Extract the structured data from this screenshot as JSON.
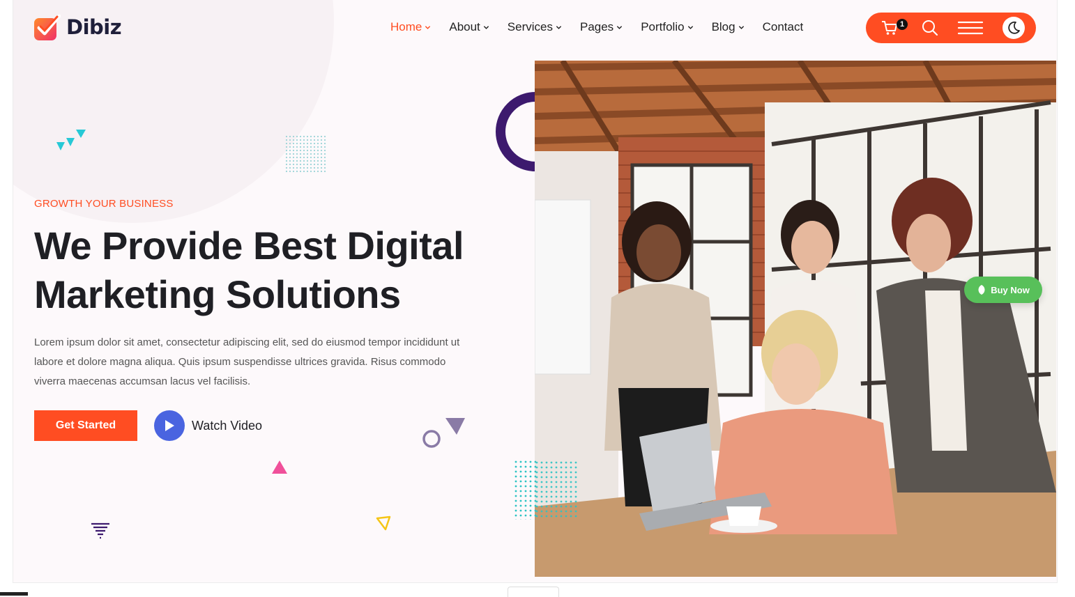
{
  "brand": {
    "name": "Dibiz",
    "accent": "#ff4d22"
  },
  "nav": {
    "items": [
      {
        "label": "Home",
        "dropdown": true,
        "active": true
      },
      {
        "label": "About",
        "dropdown": true
      },
      {
        "label": "Services",
        "dropdown": true
      },
      {
        "label": "Pages",
        "dropdown": true
      },
      {
        "label": "Portfolio",
        "dropdown": true
      },
      {
        "label": "Blog",
        "dropdown": true
      },
      {
        "label": "Contact",
        "dropdown": false
      }
    ]
  },
  "toolbar": {
    "cart_count": "1",
    "icons": [
      "cart-icon",
      "search-icon",
      "menu-icon",
      "moon-icon"
    ]
  },
  "hero": {
    "eyebrow": "GROWTH YOUR BUSINESS",
    "title_line1": "We Provide Best Digital",
    "title_line2": "Marketing Solutions",
    "paragraph": "Lorem ipsum dolor sit amet, consectetur adipiscing elit, sed do eiusmod tempor incididunt ut labore et dolore magna aliqua. Quis ipsum suspendisse ultrices gravida. Risus commodo viverra maecenas accumsan lacus vel facilisis.",
    "cta_label": "Get Started",
    "video_label": "Watch Video"
  },
  "floating": {
    "buy_now_label": "Buy Now",
    "buy_now_color": "#58c05a"
  },
  "colors": {
    "play_button": "#4a64e0",
    "ring": "#3d1a6e",
    "teal": "#2cc3c3",
    "pink": "#f0509a"
  }
}
